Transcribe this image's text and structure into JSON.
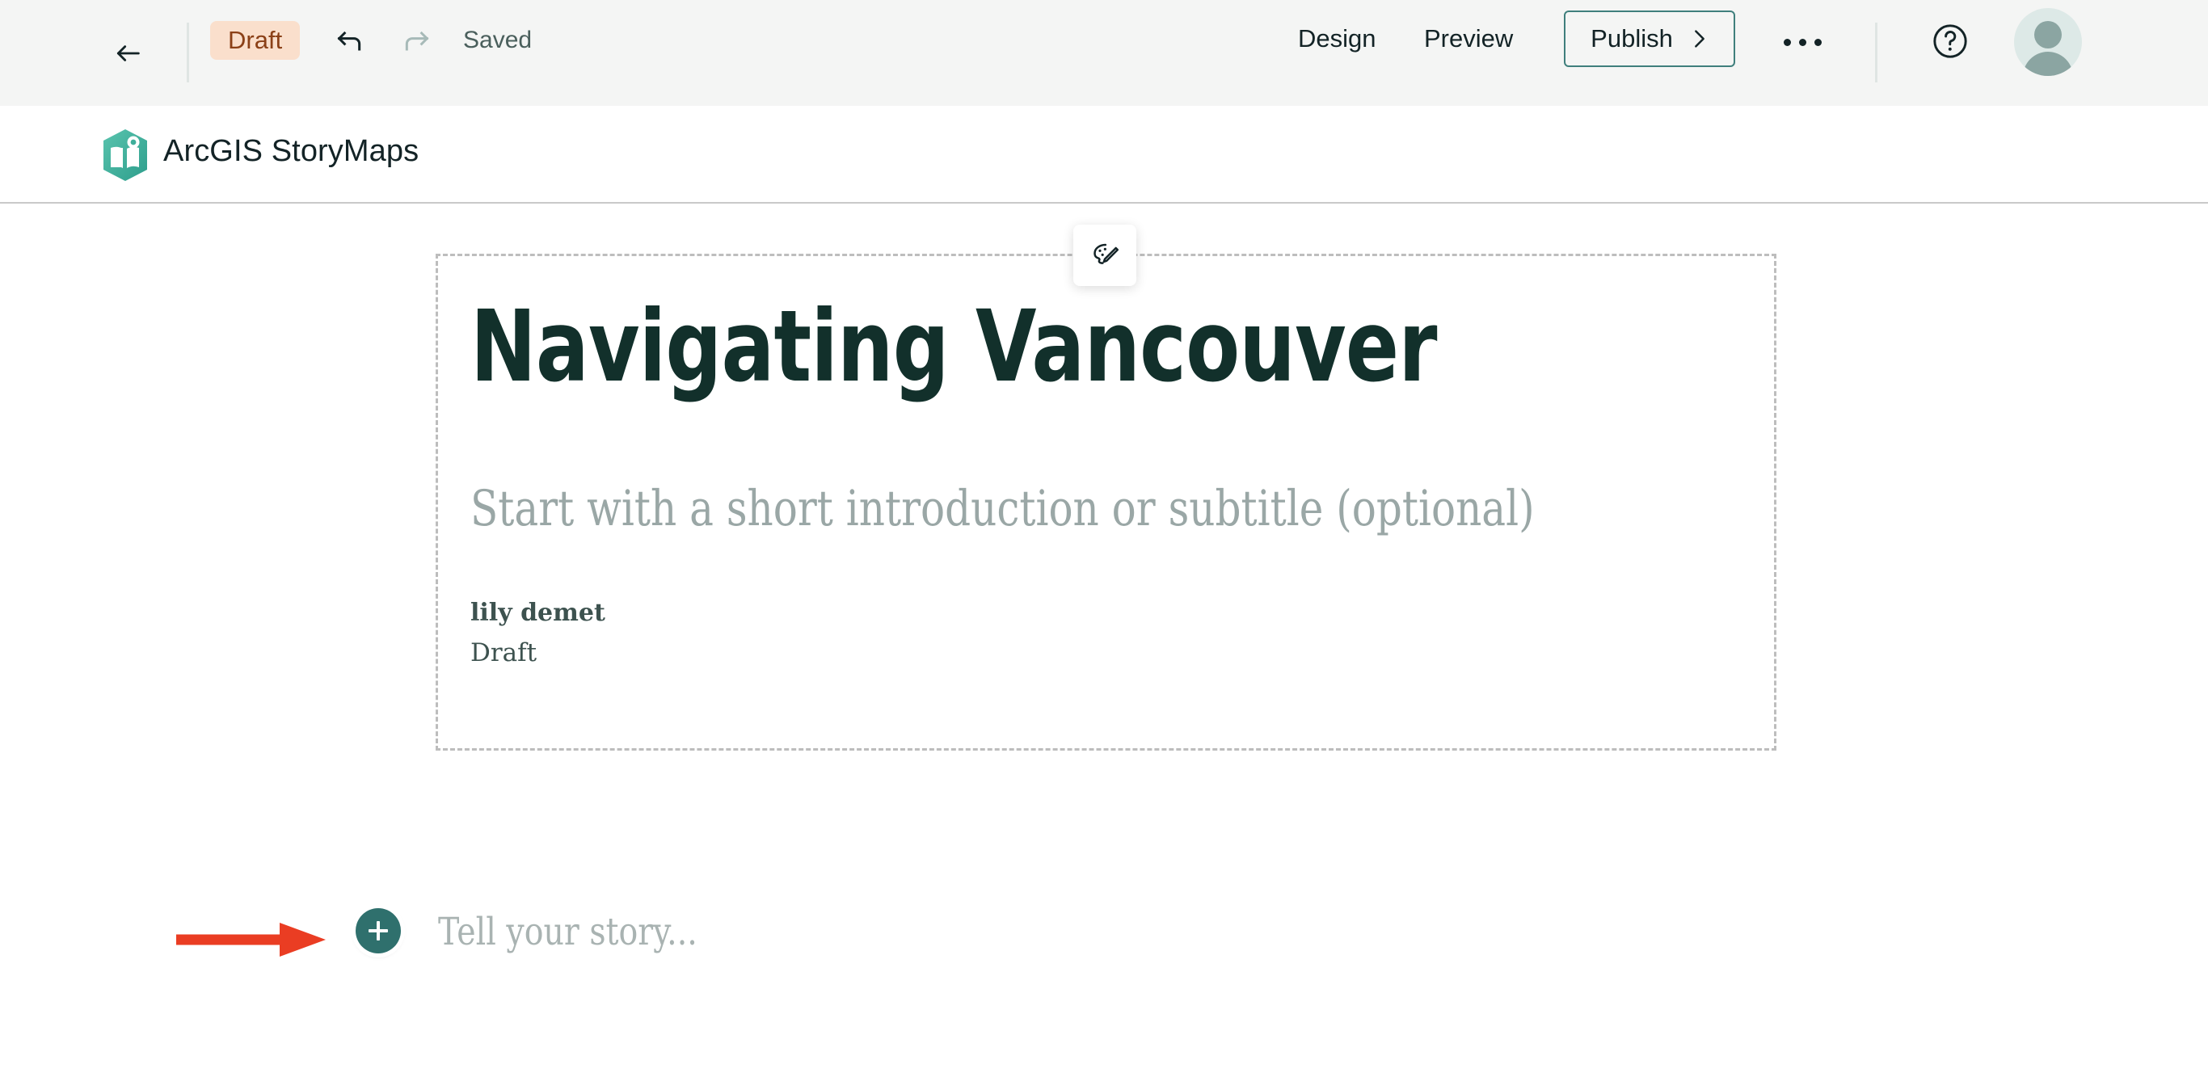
{
  "toolbar": {
    "back_label": "Back",
    "status_badge": "Draft",
    "undo_label": "Undo",
    "redo_label": "Redo",
    "save_state": "Saved",
    "design_label": "Design",
    "preview_label": "Preview",
    "publish_label": "Publish",
    "more_label": "More options",
    "help_label": "Help",
    "avatar_label": "Account",
    "colors": {
      "bar_background": "#f4f5f4",
      "badge_background": "#fadfcc",
      "badge_text": "#8b4017",
      "publish_border": "#3f7f7c",
      "text": "#132326"
    }
  },
  "brand": {
    "product_name": "ArcGIS StoryMaps",
    "logo_color": "#3fae9a"
  },
  "cover": {
    "title": "Navigating Vancouver",
    "subtitle_placeholder": "Start with a short introduction or subtitle (optional)",
    "author": "lily demet",
    "status": "Draft",
    "design_tool_label": "Cover design options",
    "border_color": "#bdbdbd"
  },
  "story": {
    "add_block_label": "Add block",
    "placeholder": "Tell your story...",
    "add_button_color": "#2f706d"
  },
  "annotation": {
    "arrow_color": "#ea3d23",
    "arrow_label": "pointer-arrow-to-add-block"
  }
}
